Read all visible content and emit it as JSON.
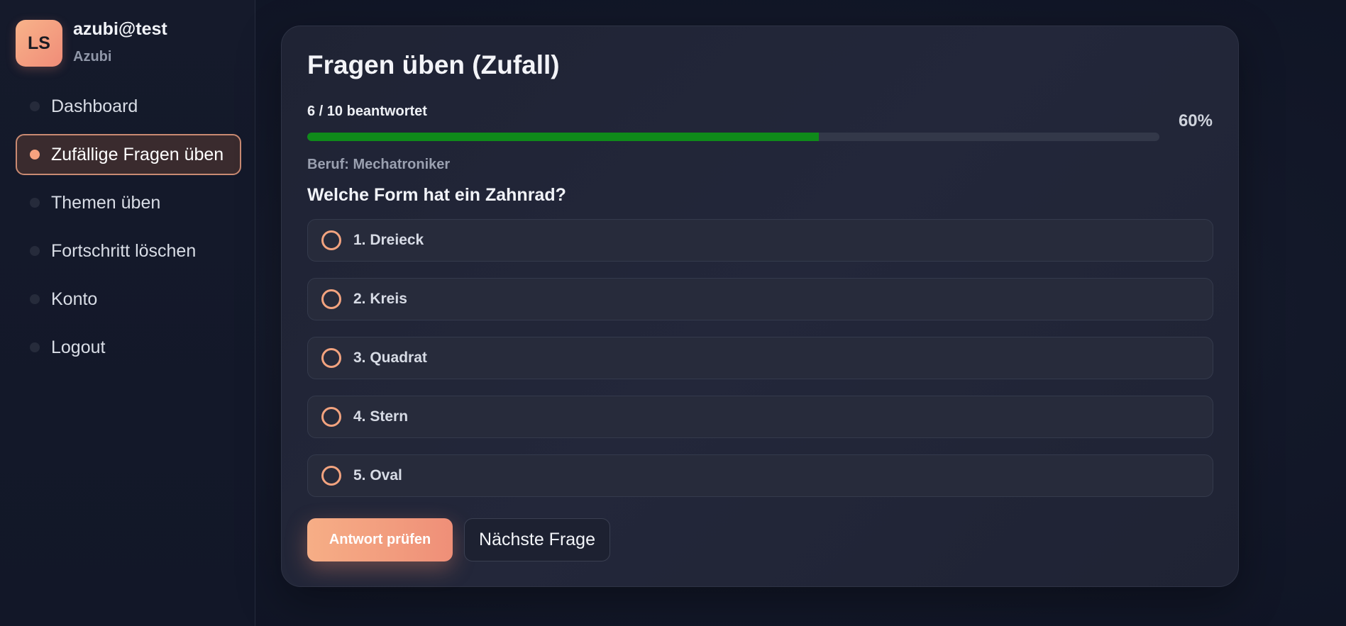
{
  "user": {
    "initials": "LS",
    "name": "azubi@test",
    "role": "Azubi"
  },
  "nav": {
    "items": [
      {
        "label": "Dashboard",
        "active": false
      },
      {
        "label": "Zufällige Fragen üben",
        "active": true
      },
      {
        "label": "Themen üben",
        "active": false
      },
      {
        "label": "Fortschritt löschen",
        "active": false
      },
      {
        "label": "Konto",
        "active": false
      },
      {
        "label": "Logout",
        "active": false
      }
    ]
  },
  "quiz": {
    "title": "Fragen üben (Zufall)",
    "progress_text": "6 / 10 beantwortet",
    "progress_percent_label": "60%",
    "progress_fraction": 0.6,
    "beruf": "Beruf: Mechatroniker",
    "question": "Welche Form hat ein Zahnrad?",
    "answers": [
      "1. Dreieck",
      "2. Kreis",
      "3. Quadrat",
      "4. Stern",
      "5. Oval"
    ],
    "check_button": "Antwort prüfen",
    "next_button": "Nächste Frage"
  },
  "colors": {
    "accent": "#f6ae86",
    "progress": "#0f8a1a",
    "background": "#111627"
  }
}
